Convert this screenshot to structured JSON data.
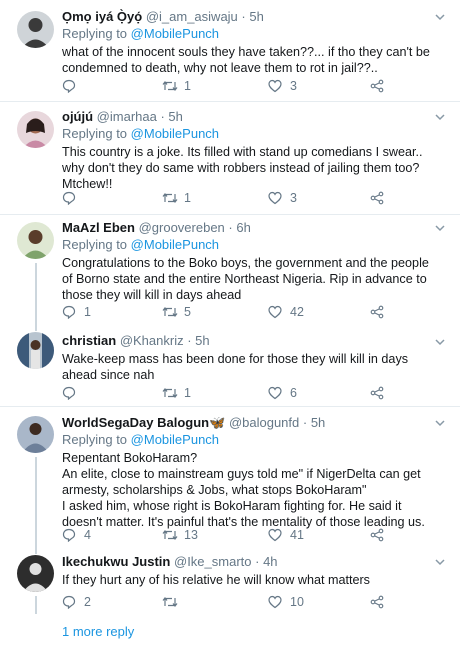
{
  "colors": {
    "link": "#1b95e0",
    "muted": "#657786",
    "text": "#14171a",
    "divider": "#e6ecf0"
  },
  "replying_label": "Replying to",
  "tweets": [
    {
      "name": "Ọmọ iyá Ọ̀yọ́",
      "handle": "@i_am_asiwaju",
      "time": "5h",
      "reply_to": "@MobilePunch",
      "text": [
        "what of the innocent souls they have taken??... if tho they can't be condemned to death, why not leave them to rot in jail??.."
      ],
      "replies": "",
      "retweets": "1",
      "likes": "3",
      "avatar_color": "#3a3a3a"
    },
    {
      "name": "ojújú",
      "handle": "@imarhaa",
      "time": "5h",
      "reply_to": "@MobilePunch",
      "text": [
        "This country is a joke. Its filled with stand up comedians I swear.. why don't they do same with robbers instead of jailing them too?",
        "Mtchew!!"
      ],
      "replies": "",
      "retweets": "1",
      "likes": "3",
      "avatar_color": "#c98aa5"
    },
    {
      "name": "MaAzl Eben",
      "handle": "@groovereben",
      "time": "6h",
      "reply_to": "@MobilePunch",
      "text": [
        "Congratulations to the Boko boys, the government and the people of Borno state and the entire Northeast Nigeria. Rip in advance to those they will kill in days ahead"
      ],
      "replies": "1",
      "retweets": "5",
      "likes": "42",
      "avatar_color": "#7fa36b"
    },
    {
      "name": "christian",
      "handle": "@Khankriz",
      "time": "5h",
      "reply_to": "",
      "text": [
        "Wake-keep mass has been done for those they will kill in days ahead since nah"
      ],
      "replies": "",
      "retweets": "1",
      "likes": "6",
      "avatar_color": "#5b6e8a"
    },
    {
      "name": "WorldSegaDay Balogun🦋",
      "handle": "@balogunfd",
      "time": "5h",
      "reply_to": "@MobilePunch",
      "text": [
        "Repentant BokoHaram?",
        "An elite, close to mainstream guys told me\" if NigerDelta can get armesty, scholarships & Jobs, what stops BokoHaram\"",
        "I asked him, whose right is BokoHaram fighting for. He said it doesn't matter. It's painful that's the mentality of those leading us."
      ],
      "replies": "4",
      "retweets": "13",
      "likes": "41",
      "avatar_color": "#6d7f99"
    },
    {
      "name": "Ikechukwu Justin",
      "handle": "@Ike_smarto",
      "time": "4h",
      "reply_to": "",
      "text": [
        "If they hurt any of his relative he will know what matters"
      ],
      "replies": "2",
      "retweets": "",
      "likes": "10",
      "avatar_color": "#2d2d2d"
    }
  ],
  "more_replies": "1 more reply"
}
